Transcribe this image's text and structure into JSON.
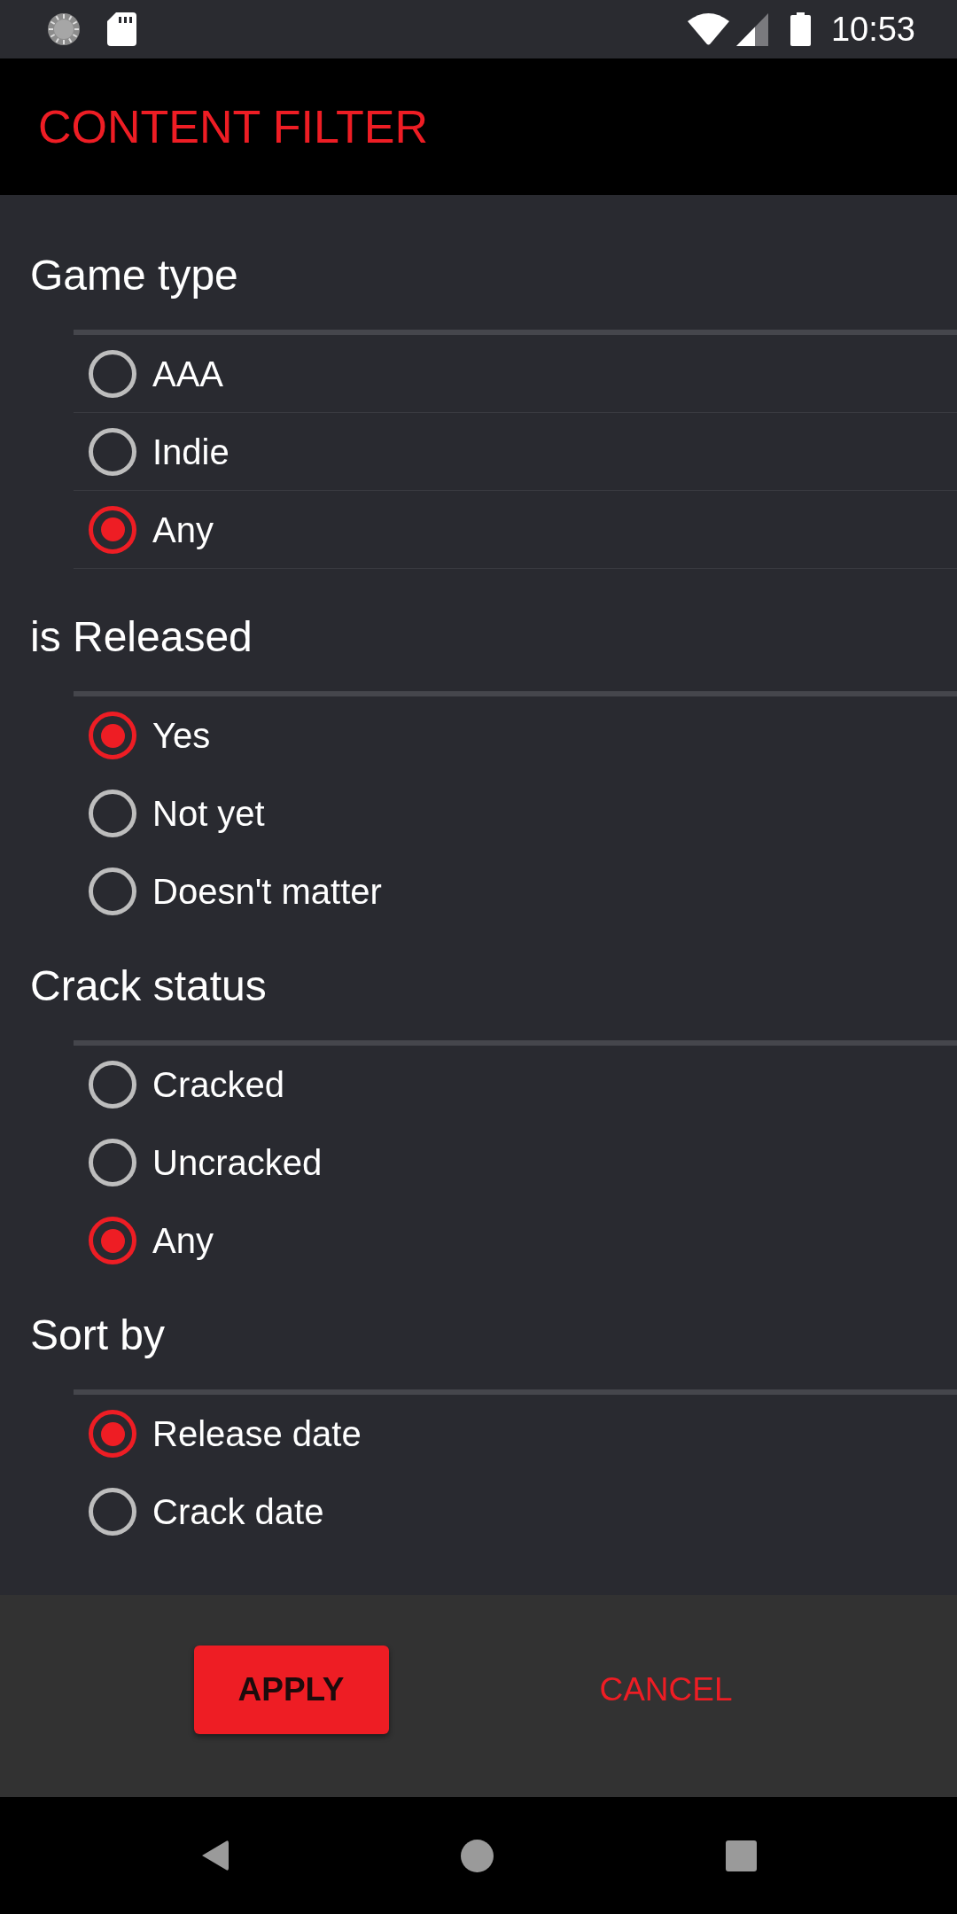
{
  "status_bar": {
    "time": "10:53"
  },
  "app_bar": {
    "title": "CONTENT FILTER"
  },
  "sections": [
    {
      "title": "Game type",
      "row_dividers": true,
      "options": [
        {
          "label": "AAA",
          "selected": false
        },
        {
          "label": "Indie",
          "selected": false
        },
        {
          "label": "Any",
          "selected": true
        }
      ]
    },
    {
      "title": "is Released",
      "row_dividers": false,
      "options": [
        {
          "label": "Yes",
          "selected": true
        },
        {
          "label": "Not yet",
          "selected": false
        },
        {
          "label": "Doesn't matter",
          "selected": false
        }
      ]
    },
    {
      "title": "Crack status",
      "row_dividers": false,
      "options": [
        {
          "label": "Cracked",
          "selected": false
        },
        {
          "label": "Uncracked",
          "selected": false
        },
        {
          "label": "Any",
          "selected": true
        }
      ]
    },
    {
      "title": "Sort by",
      "row_dividers": false,
      "options": [
        {
          "label": "Release date",
          "selected": true
        },
        {
          "label": "Crack date",
          "selected": false
        }
      ]
    }
  ],
  "buttons": [
    {
      "label": "APPLY",
      "kind": "primary"
    },
    {
      "label": "CANCEL",
      "kind": "text"
    }
  ]
}
